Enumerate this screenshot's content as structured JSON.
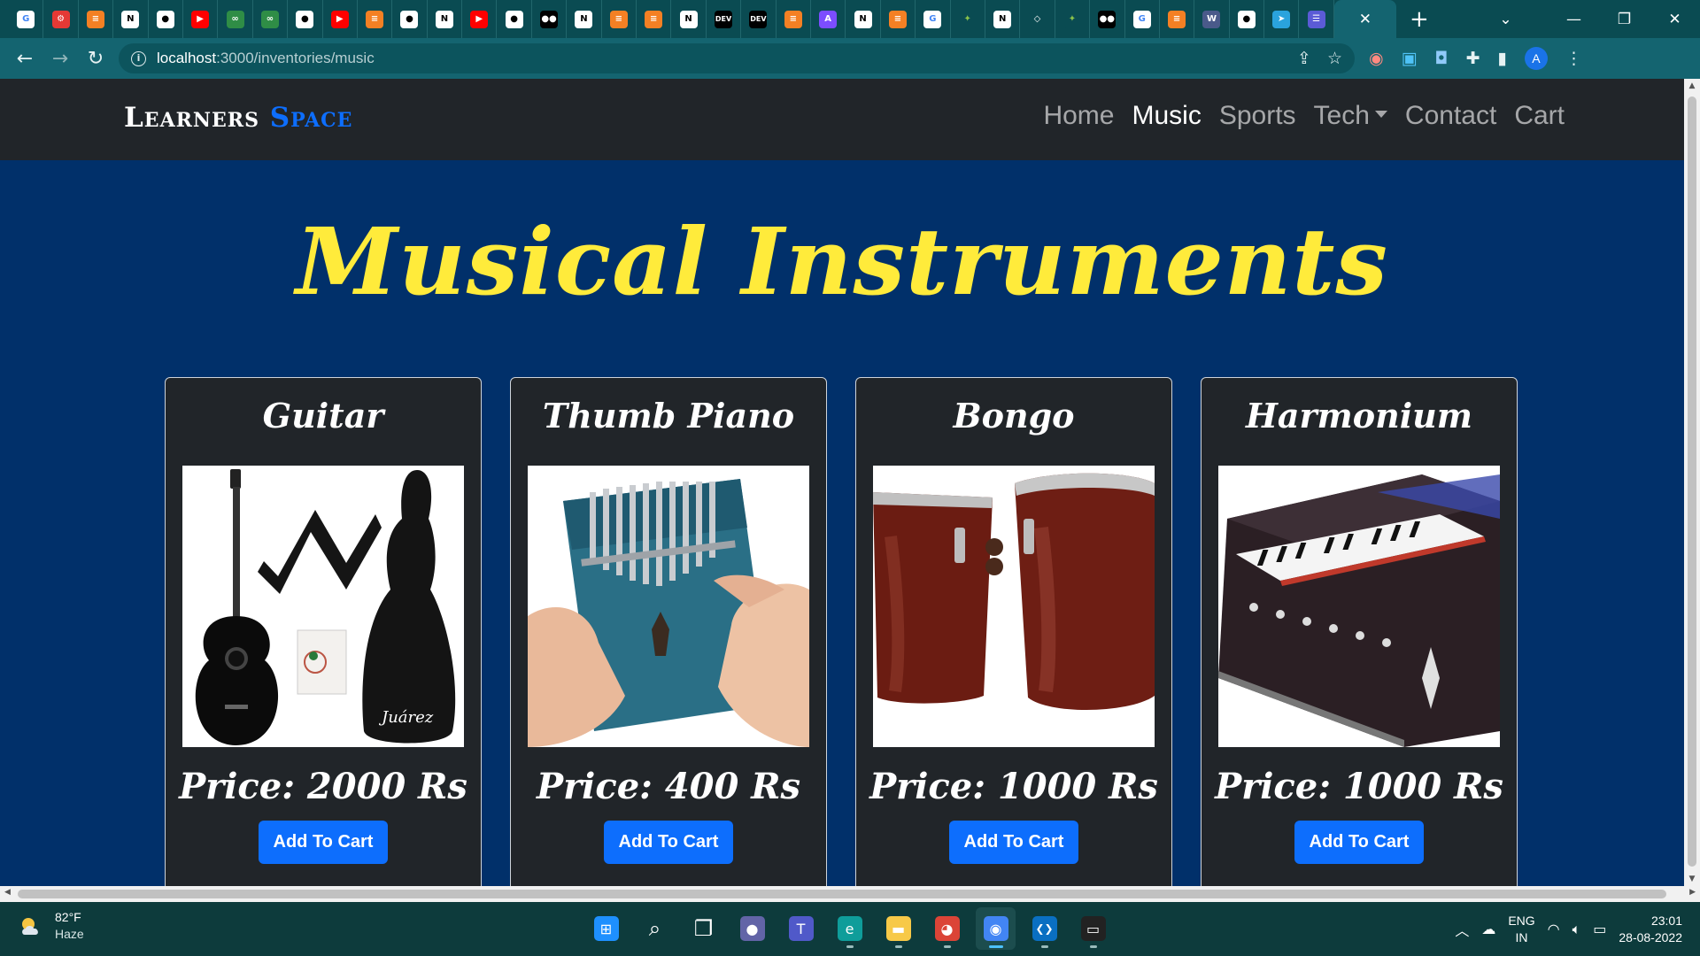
{
  "browser": {
    "tabs": [
      {
        "icon": "google-icon",
        "color": "#ffffff",
        "glyph": "G",
        "fg": "#4285f4"
      },
      {
        "icon": "settings-gear-icon",
        "color": "#e53935",
        "glyph": "⚙",
        "fg": "#ffffff"
      },
      {
        "icon": "stackoverflow-icon",
        "color": "#f48024",
        "glyph": "≡",
        "fg": "#ffffff"
      },
      {
        "icon": "notion-icon",
        "color": "#ffffff",
        "glyph": "N",
        "fg": "#000000"
      },
      {
        "icon": "github-icon",
        "color": "#ffffff",
        "glyph": "●",
        "fg": "#000000"
      },
      {
        "icon": "youtube-icon",
        "color": "#ff0000",
        "glyph": "▶",
        "fg": "#ffffff"
      },
      {
        "icon": "geeksforgeeks-icon",
        "color": "#2f8d46",
        "glyph": "∞",
        "fg": "#ffffff"
      },
      {
        "icon": "geeksforgeeks-icon",
        "color": "#2f8d46",
        "glyph": "∞",
        "fg": "#ffffff"
      },
      {
        "icon": "github-icon",
        "color": "#ffffff",
        "glyph": "●",
        "fg": "#000000"
      },
      {
        "icon": "youtube-icon",
        "color": "#ff0000",
        "glyph": "▶",
        "fg": "#ffffff"
      },
      {
        "icon": "stackoverflow-icon",
        "color": "#f48024",
        "glyph": "≡",
        "fg": "#ffffff"
      },
      {
        "icon": "github-icon",
        "color": "#ffffff",
        "glyph": "●",
        "fg": "#000000"
      },
      {
        "icon": "notion-icon",
        "color": "#ffffff",
        "glyph": "N",
        "fg": "#000000"
      },
      {
        "icon": "youtube-icon",
        "color": "#ff0000",
        "glyph": "▶",
        "fg": "#ffffff"
      },
      {
        "icon": "github-icon",
        "color": "#ffffff",
        "glyph": "●",
        "fg": "#000000"
      },
      {
        "icon": "medium-icon",
        "color": "#000000",
        "glyph": "●●",
        "fg": "#ffffff"
      },
      {
        "icon": "notion-icon",
        "color": "#ffffff",
        "glyph": "N",
        "fg": "#000000"
      },
      {
        "icon": "stackoverflow-icon",
        "color": "#f48024",
        "glyph": "≡",
        "fg": "#ffffff"
      },
      {
        "icon": "stackoverflow-icon",
        "color": "#f48024",
        "glyph": "≡",
        "fg": "#ffffff"
      },
      {
        "icon": "notion-icon",
        "color": "#ffffff",
        "glyph": "N",
        "fg": "#000000"
      },
      {
        "icon": "dev-icon",
        "color": "#000000",
        "glyph": "DEV",
        "fg": "#ffffff"
      },
      {
        "icon": "dev-icon",
        "color": "#000000",
        "glyph": "DEV",
        "fg": "#ffffff"
      },
      {
        "icon": "stackoverflow-icon",
        "color": "#f48024",
        "glyph": "≡",
        "fg": "#ffffff"
      },
      {
        "icon": "app-icon",
        "color": "#7c4dff",
        "glyph": "A",
        "fg": "#ffffff"
      },
      {
        "icon": "notion-icon",
        "color": "#ffffff",
        "glyph": "N",
        "fg": "#000000"
      },
      {
        "icon": "stackoverflow-icon",
        "color": "#f48024",
        "glyph": "≡",
        "fg": "#ffffff"
      },
      {
        "icon": "google-icon",
        "color": "#ffffff",
        "glyph": "G",
        "fg": "#4285f4"
      },
      {
        "icon": "sparkle-icon",
        "color": "#0a4b52",
        "glyph": "✦",
        "fg": "#8bc34a"
      },
      {
        "icon": "notion-icon",
        "color": "#ffffff",
        "glyph": "N",
        "fg": "#000000"
      },
      {
        "icon": "cube-icon",
        "color": "#0a4b52",
        "glyph": "◇",
        "fg": "#ffffff"
      },
      {
        "icon": "sparkle-icon",
        "color": "#0a4b52",
        "glyph": "✦",
        "fg": "#8bc34a"
      },
      {
        "icon": "medium-icon",
        "color": "#000000",
        "glyph": "●●",
        "fg": "#ffffff"
      },
      {
        "icon": "google-icon",
        "color": "#ffffff",
        "glyph": "G",
        "fg": "#4285f4"
      },
      {
        "icon": "stackoverflow-icon",
        "color": "#f48024",
        "glyph": "≡",
        "fg": "#ffffff"
      },
      {
        "icon": "w3schools-icon",
        "color": "#4a5a8a",
        "glyph": "W",
        "fg": "#ffffff"
      },
      {
        "icon": "github-icon",
        "color": "#ffffff",
        "glyph": "●",
        "fg": "#000000"
      },
      {
        "icon": "telegram-icon",
        "color": "#2aa3dd",
        "glyph": "➤",
        "fg": "#ffffff"
      },
      {
        "icon": "list-app-icon",
        "color": "#5b5bd6",
        "glyph": "☰",
        "fg": "#ffffff"
      }
    ],
    "url_host": "localhost",
    "url_path": ":3000/inventories/music"
  },
  "site": {
    "brand_main": "Learners",
    "brand_accent": "Space",
    "nav": [
      {
        "label": "Home",
        "active": false
      },
      {
        "label": "Music",
        "active": true
      },
      {
        "label": "Sports",
        "active": false
      },
      {
        "label": "Tech",
        "active": false,
        "dropdown": true
      },
      {
        "label": "Contact",
        "active": false
      },
      {
        "label": "Cart",
        "active": false
      }
    ],
    "hero_title": "Musical Instruments",
    "accent_color": "#ffeb3b",
    "button_color": "#0d6efd",
    "products": [
      {
        "name": "Guitar",
        "price": "Price: 2000 Rs",
        "button": "Add To Cart",
        "image": "guitar-image"
      },
      {
        "name": "Thumb Piano",
        "price": "Price: 400 Rs",
        "button": "Add To Cart",
        "image": "thumb-piano-image"
      },
      {
        "name": "Bongo",
        "price": "Price: 1000 Rs",
        "button": "Add To Cart",
        "image": "bongo-image"
      },
      {
        "name": "Harmonium",
        "price": "Price: 1000 Rs",
        "button": "Add To Cart",
        "image": "harmonium-image"
      }
    ]
  },
  "taskbar": {
    "temperature": "82°F",
    "condition": "Haze",
    "language": "ENG",
    "region": "IN",
    "time": "23:01",
    "date": "28-08-2022",
    "apps": [
      "start-icon",
      "search-icon",
      "task-view-icon",
      "chat-icon",
      "teams-icon",
      "edge-icon",
      "file-explorer-icon",
      "chrome-profile-icon",
      "chrome-icon",
      "vscode-icon",
      "terminal-icon"
    ]
  }
}
